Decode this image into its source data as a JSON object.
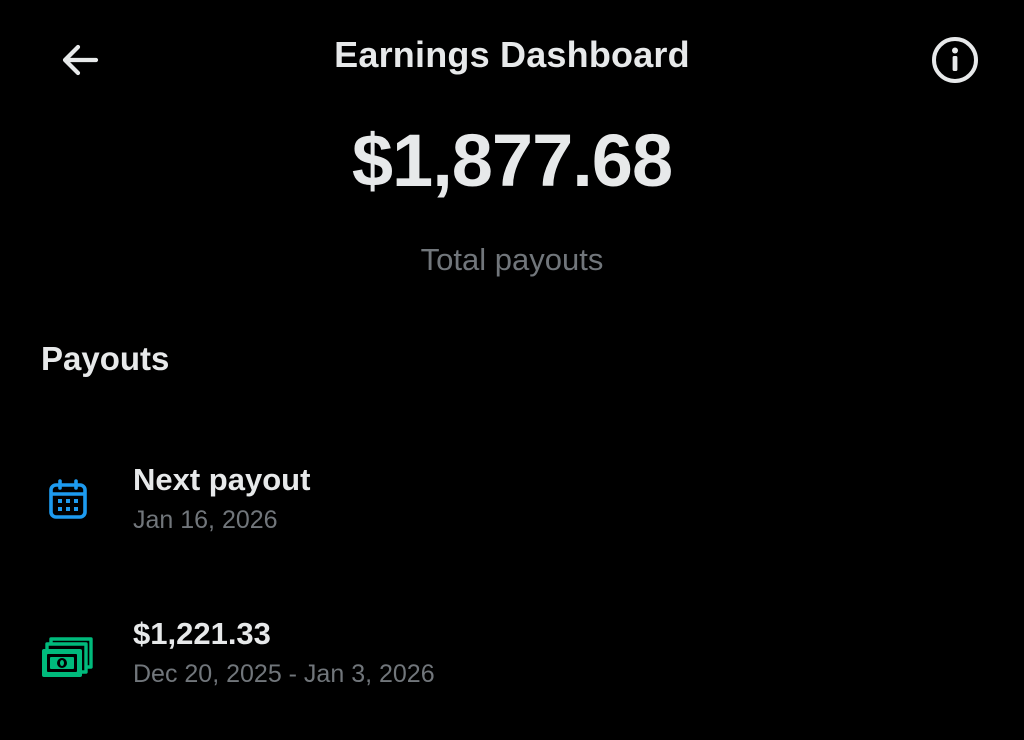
{
  "header": {
    "title": "Earnings Dashboard",
    "back_icon": "arrow-left-icon",
    "info_icon": "info-circle-icon"
  },
  "summary": {
    "total_amount": "$1,877.68",
    "total_label": "Total payouts"
  },
  "payouts": {
    "section_title": "Payouts",
    "items": [
      {
        "icon": "calendar-icon",
        "icon_color": "#1d9bf0",
        "primary": "Next payout",
        "secondary": "Jan 16, 2026"
      },
      {
        "icon": "money-icon",
        "icon_color": "#00ba7c",
        "primary": "$1,221.33",
        "secondary": "Dec 20, 2025 - Jan 3, 2026"
      }
    ]
  },
  "colors": {
    "background": "#000000",
    "primary_text": "#e7e9ea",
    "secondary_text": "#71767b"
  }
}
